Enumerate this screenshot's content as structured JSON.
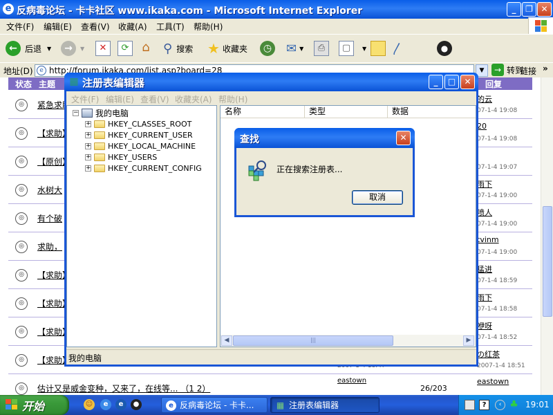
{
  "ie": {
    "title": "反病毒论坛 - 卡卡社区 www.ikaka.com - Microsoft Internet Explorer",
    "menu": [
      "文件(F)",
      "编辑(E)",
      "查看(V)",
      "收藏(A)",
      "工具(T)",
      "帮助(H)"
    ],
    "toolbar": {
      "back": "后退",
      "search": "搜索",
      "favorites": "收藏夹"
    },
    "address": {
      "label": "地址(D)",
      "url": "http://forum.ikaka.com/list.asp?board=28",
      "go": "转到",
      "links": "链接"
    },
    "forum": {
      "header_status": "状态",
      "header_topic": "主题",
      "header_last": "回复",
      "rows": [
        {
          "topic": "紧急求助",
          "last_author": "的云",
          "last_time": "07-1-4 19:08"
        },
        {
          "topic": "【求助】",
          "last_author": "20",
          "last_time": "07-1-4 19:08"
        },
        {
          "topic": "【原创】",
          "last_author": "",
          "last_time": "07-1-4 19:07"
        },
        {
          "topic": "水树大",
          "last_author": "雨下",
          "last_time": "07-1-4 19:00"
        },
        {
          "topic": "有个破",
          "last_author": "喷人",
          "last_time": "07-1-4 19:00"
        },
        {
          "topic": "求助，",
          "last_author": "tvinm",
          "last_time": "07-1-4 19:00"
        },
        {
          "topic": "【求助】",
          "last_author": "猛进",
          "last_time": "07-1-4 18:59"
        },
        {
          "topic": "【求助】",
          "last_author": "雨下",
          "last_time": "07-1-4 18:58"
        },
        {
          "topic": "【求助】",
          "last_author": "咿呀",
          "last_time": "07-1-4 18:52"
        },
        {
          "topic": "【求助】",
          "last_author": "の红茶",
          "last_time": "2007-1-4 18:51",
          "mid_time": "2007-1-4 18:47"
        },
        {
          "topic": "估计又是威金变种，又来了，在线等... （1 2）",
          "mid_author": "eastown",
          "count": "26/203",
          "last_author": "eastown",
          "last_time": ""
        }
      ]
    }
  },
  "regedit": {
    "title": "注册表编辑器",
    "menu": [
      "文件(F)",
      "编辑(E)",
      "查看(V)",
      "收藏夹(A)",
      "帮助(H)"
    ],
    "tree": {
      "root": "我的电脑",
      "keys": [
        "HKEY_CLASSES_ROOT",
        "HKEY_CURRENT_USER",
        "HKEY_LOCAL_MACHINE",
        "HKEY_USERS",
        "HKEY_CURRENT_CONFIG"
      ]
    },
    "columns": [
      "名称",
      "类型",
      "数据"
    ],
    "status": "我的电脑"
  },
  "find": {
    "title": "查找",
    "message": "正在搜索注册表...",
    "cancel": "取消"
  },
  "taskbar": {
    "start": "开始",
    "tasks": [
      "反病毒论坛 - 卡卡...",
      "注册表编辑器"
    ],
    "clock": "19:01"
  },
  "colors": {
    "xp_blue": "#0a5ee8",
    "forum_header": "#7e6cc4",
    "start_green": "#3a9a3a"
  }
}
